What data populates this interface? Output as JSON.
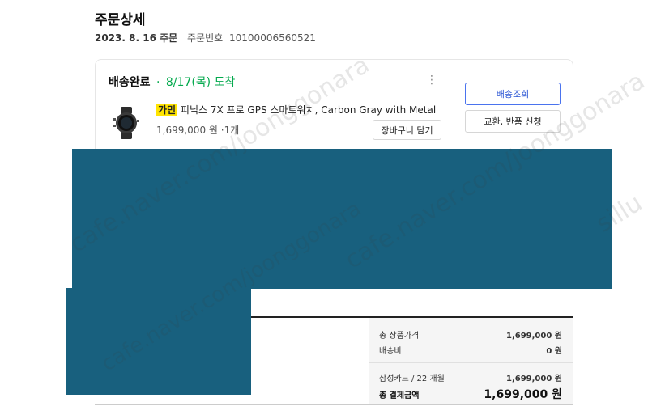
{
  "page": {
    "title": "주문상세",
    "order_date": "2023. 8. 16 주문",
    "order_number_label": "주문번호",
    "order_number": "10100006560521"
  },
  "delivery": {
    "status": "배송완료",
    "separator": "·",
    "arrival": "8/17(목) 도착",
    "menu_glyph": "⋮"
  },
  "product": {
    "brand": "가민",
    "name": "피닉스 7X 프로 GPS 스마트워치, Carbon Gray with Metal",
    "price": "1,699,000 원",
    "qty": "·1개",
    "cart_button": "장바구니 담기"
  },
  "actions": {
    "track": "배송조회",
    "return_exchange": "교환, 반품 신청"
  },
  "summary": {
    "product_total_label": "총 상품가격",
    "product_total_value": "1,699,000 원",
    "shipping_label": "배송비",
    "shipping_value": "0 원",
    "payment_method": "삼성카드 / 22 개월",
    "payment_value": "1,699,000 원",
    "grand_total_label": "총 결제금액",
    "grand_total_value": "1,699,000 원"
  },
  "watermarks": [
    "cafe.naver.com/joonggonara",
    "cafe.naver.com/joonggonara",
    "cafe.naver.com/joonggonara",
    "sillu"
  ],
  "colors": {
    "accent_green": "#03a94d",
    "accent_blue": "#2a55d4",
    "highlight_yellow": "#ffe400",
    "redaction": "#18607e"
  }
}
